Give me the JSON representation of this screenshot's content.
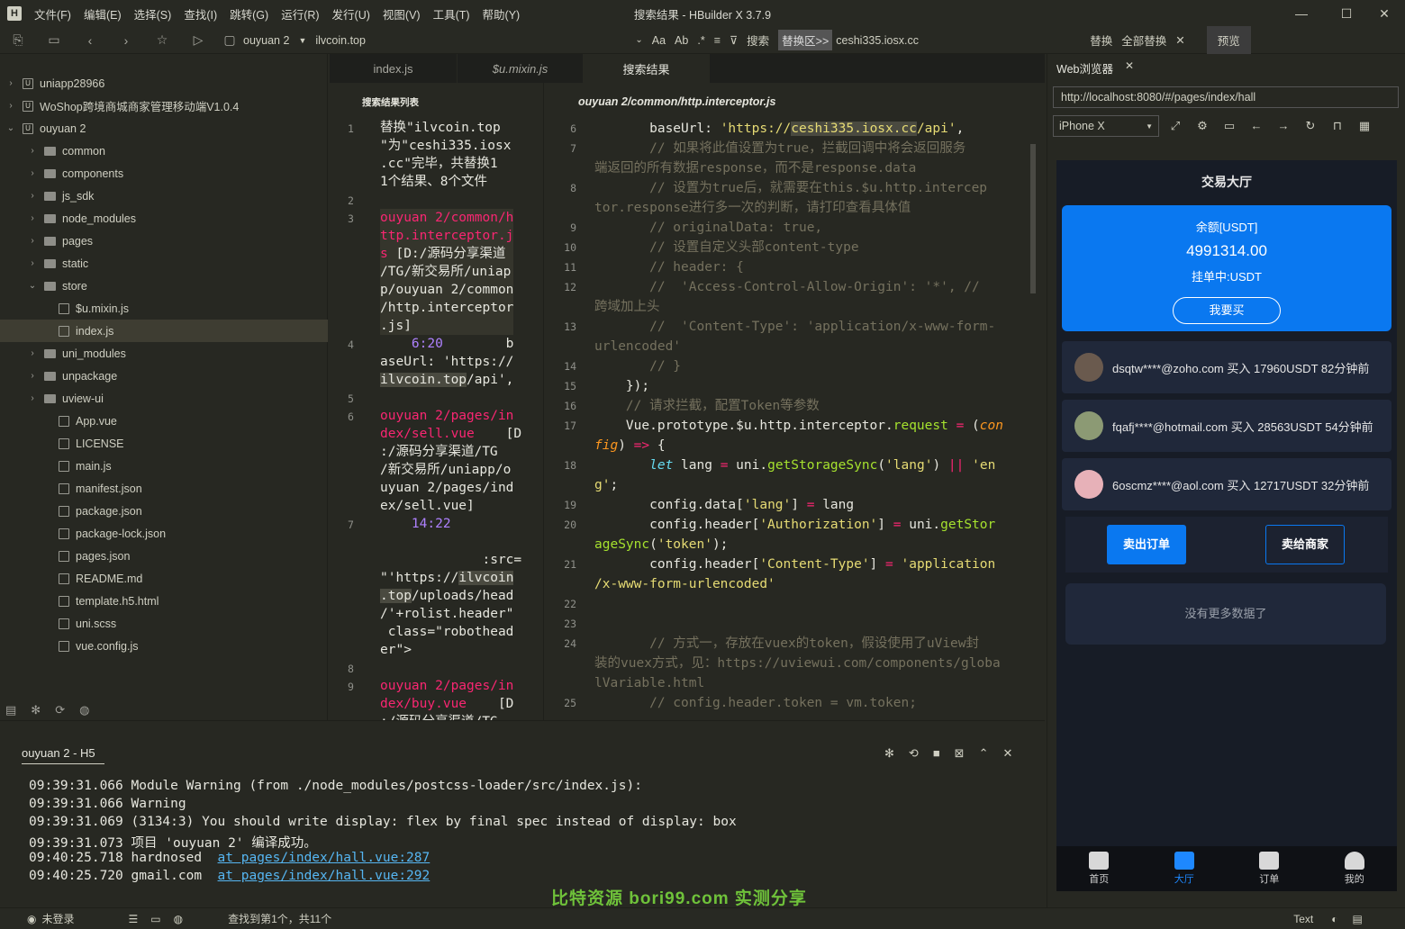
{
  "app": {
    "title": "搜索结果 - HBuilder X 3.7.9",
    "menu": [
      "文件(F)",
      "编辑(E)",
      "选择(S)",
      "查找(I)",
      "跳转(G)",
      "运行(R)",
      "发行(U)",
      "视图(V)",
      "工具(T)",
      "帮助(Y)"
    ]
  },
  "toolbar": {
    "project": "ouyuan 2",
    "search_term": "ilvcoin.top",
    "search_label": "搜索",
    "replace_area": "替换区>>",
    "replace_term": "ceshi335.iosx.cc",
    "replace_label": "替换",
    "replace_all_label": "全部替换",
    "preview_label": "预览"
  },
  "sidebar": {
    "items": [
      {
        "label": "uniapp28966",
        "type": "project"
      },
      {
        "label": "WoShop跨境商城商家管理移动端V1.0.4",
        "type": "project"
      },
      {
        "label": "ouyuan 2",
        "type": "project-open"
      },
      {
        "label": "common",
        "type": "folder"
      },
      {
        "label": "components",
        "type": "folder"
      },
      {
        "label": "js_sdk",
        "type": "folder"
      },
      {
        "label": "node_modules",
        "type": "folder"
      },
      {
        "label": "pages",
        "type": "folder"
      },
      {
        "label": "static",
        "type": "folder"
      },
      {
        "label": "store",
        "type": "folder-open"
      },
      {
        "label": "$u.mixin.js",
        "type": "file"
      },
      {
        "label": "index.js",
        "type": "file-selected"
      },
      {
        "label": "uni_modules",
        "type": "folder"
      },
      {
        "label": "unpackage",
        "type": "folder"
      },
      {
        "label": "uview-ui",
        "type": "folder"
      },
      {
        "label": "App.vue",
        "type": "file"
      },
      {
        "label": "LICENSE",
        "type": "file"
      },
      {
        "label": "main.js",
        "type": "file"
      },
      {
        "label": "manifest.json",
        "type": "file"
      },
      {
        "label": "package.json",
        "type": "file"
      },
      {
        "label": "package-lock.json",
        "type": "file"
      },
      {
        "label": "pages.json",
        "type": "file"
      },
      {
        "label": "README.md",
        "type": "file"
      },
      {
        "label": "template.h5.html",
        "type": "file"
      },
      {
        "label": "uni.scss",
        "type": "file"
      },
      {
        "label": "vue.config.js",
        "type": "file"
      }
    ]
  },
  "tabs": [
    "index.js",
    "$u.mixin.js",
    "搜索结果"
  ],
  "search_results": {
    "heading": "搜索结果列表",
    "summary": "替换\"ilvcoin.top\"为\"ceshi335.iosx.cc\"完毕，共替换11个结果、8个文件",
    "file1": "ouyuan 2/common/http.interceptor.js",
    "file1_path": "[D:/源码分享渠道/TG/新交易所/uniapp/ouyuan 2/common/http.interceptor.js]",
    "match1_pos": "6:20",
    "match1_text": "baseUrl: 'https://ilvcoin.top/api',",
    "file2": "ouyuan 2/pages/index/sell.vue",
    "file2_path": "[D:/源码分享渠道/TG/新交易所/uniapp/ouyuan 2/pages/index/sell.vue]",
    "match2_pos": "14:22",
    "match2_text": ":src=\"'https://ilvcoin.top/uploads/head/'+rolist.header\" class=\"robothead er\">",
    "file3": "ouyuan 2/pages/index/buy.vue",
    "file3_path": "[D"
  },
  "code": {
    "heading": "ouyuan 2/common/http.interceptor.js",
    "line_numbers": [
      "6",
      "7",
      "8",
      "9",
      "10",
      "11",
      "12",
      "13",
      "14",
      "15",
      "16",
      "17",
      "18",
      "19",
      "20",
      "21",
      "22",
      "23",
      "24",
      "25"
    ]
  },
  "console": {
    "tab": "ouyuan 2 - H5",
    "lines": [
      {
        "time": "09:39:31.066",
        "text": "Module Warning (from ./node_modules/postcss-loader/src/index.js):"
      },
      {
        "time": "09:39:31.066",
        "text": "Warning"
      },
      {
        "time": "09:39:31.069",
        "text": "(3134:3) You should write display: flex by final spec instead of display: box"
      },
      {
        "time": "09:39:31.073",
        "text": "项目 'ouyuan 2' 编译成功。"
      },
      {
        "time": "09:40:25.718",
        "text": "hardnosed",
        "link": "at pages/index/hall.vue:287"
      },
      {
        "time": "09:40:25.720",
        "text": "gmail.com",
        "link": "at pages/index/hall.vue:292"
      }
    ],
    "watermark": "比特资源 bori99.com 实测分享"
  },
  "status": {
    "login": "未登录",
    "search_status": "查找到第1个，共11个",
    "mode": "Text"
  },
  "browser": {
    "tab": "Web浏览器",
    "url": "http://localhost:8080/#/pages/index/hall",
    "device": "iPhone X",
    "page": {
      "title": "交易大厅",
      "balance_label": "余额[USDT]",
      "balance": "4991314.00",
      "pending": "挂单中:USDT",
      "buy_button": "我要买",
      "trades": [
        {
          "text": "dsqtw****@zoho.com 买入 17960USDT 82分钟前"
        },
        {
          "text": "fqafj****@hotmail.com 买入 28563USDT 54分钟前"
        },
        {
          "text": "6oscmz****@aol.com 买入 12717USDT 32分钟前"
        }
      ],
      "sell_orders": "卖出订单",
      "sell_merchant": "卖给商家",
      "no_more": "没有更多数据了",
      "nav": [
        "首页",
        "大厅",
        "订单",
        "我的"
      ]
    }
  },
  "colors": {
    "accent": "#0a78f0",
    "editor_bg": "#272822",
    "active_nav": "#1e88ff"
  }
}
